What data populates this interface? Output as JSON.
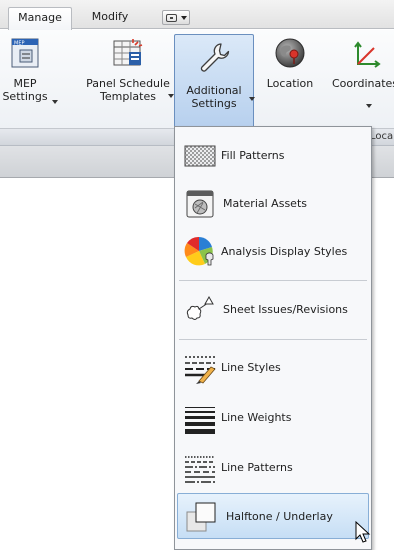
{
  "tabs": [
    {
      "label": "Manage",
      "active": true
    },
    {
      "label": "Modify",
      "active": false
    }
  ],
  "ribbon": {
    "buttons": [
      {
        "label1": "MEP",
        "label2": "Settings",
        "has_dropdown": true,
        "icon": "mep-settings-icon"
      },
      {
        "label1": "Panel Schedule",
        "label2": "Templates",
        "has_dropdown": true,
        "icon": "panel-schedule-icon"
      },
      {
        "label1": "Additional",
        "label2": "Settings",
        "has_dropdown": true,
        "icon": "wrench-icon",
        "active": true
      },
      {
        "label1": "Location",
        "label2": "",
        "has_dropdown": false,
        "icon": "globe-icon"
      },
      {
        "label1": "Coordinates",
        "label2": "",
        "has_dropdown": true,
        "icon": "coordinates-icon"
      }
    ],
    "panel_label": "Loca"
  },
  "menu": {
    "items": [
      {
        "label": "Fill Patterns",
        "icon": "fill-patterns-icon"
      },
      {
        "label": "Material Assets",
        "icon": "material-assets-icon"
      },
      {
        "label": "Analysis Display Styles",
        "icon": "analysis-display-icon"
      },
      {
        "label": "Sheet Issues/Revisions",
        "icon": "revision-cloud-icon"
      },
      {
        "label": "Line Styles",
        "icon": "line-styles-icon"
      },
      {
        "label": "Line Weights",
        "icon": "line-weights-icon"
      },
      {
        "label": "Line Patterns",
        "icon": "line-patterns-icon"
      },
      {
        "label": "Halftone / Underlay",
        "icon": "halftone-icon",
        "highlighted": true
      }
    ]
  },
  "colors": {
    "accent": "#b7d0ee",
    "highlight": "#c6def5"
  }
}
